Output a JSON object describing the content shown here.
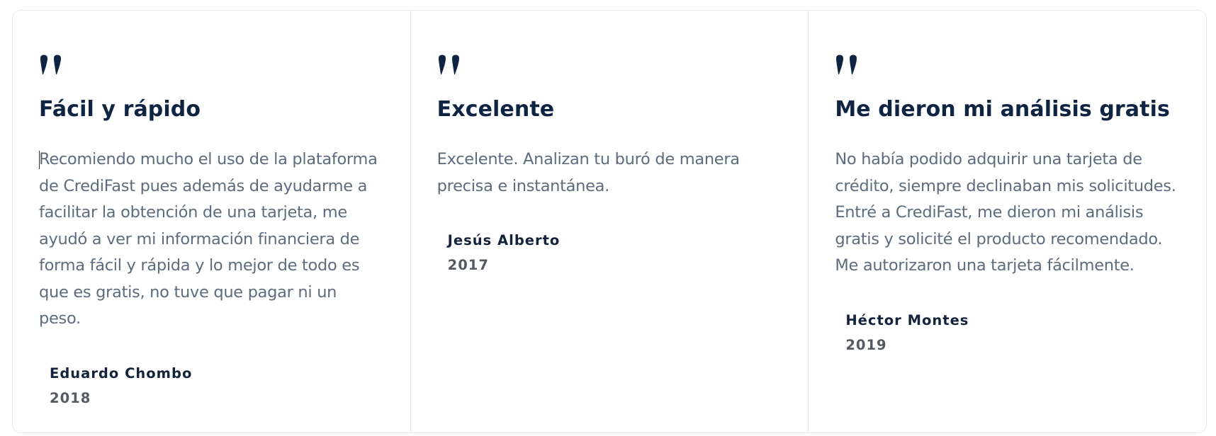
{
  "testimonials": [
    {
      "title": "Fácil y rápido",
      "text": "Recomiendo mucho el uso de la plataforma de CrediFast pues además de ayudarme a facilitar la obtención de una tarjeta, me ayudó a ver mi información financiera de forma fácil y rápida y lo mejor de todo es que es gratis, no tuve que pagar ni un peso.",
      "author": "Eduardo Chombo",
      "year": "2018"
    },
    {
      "title": "Excelente",
      "text": "Excelente. Analizan tu buró de manera precisa e instantánea.",
      "author": "Jesús Alberto",
      "year": "2017"
    },
    {
      "title": "Me dieron mi análisis gratis",
      "text": "No había podido adquirir una tarjeta de crédito, siempre declinaban mis solicitudes. Entré a CrediFast, me dieron mi análisis gratis y solicité el producto recomendado. Me autorizaron una tarjeta fácilmente.",
      "author": "Héctor Montes",
      "year": "2019"
    }
  ],
  "icons": {
    "quote": "quote-icon"
  },
  "colors": {
    "title": "#0f2442",
    "body_text": "#5d6b7e",
    "author": "#14233c",
    "year": "#545a63",
    "border": "#e6e8ec",
    "quote_icon": "#0f2442"
  }
}
